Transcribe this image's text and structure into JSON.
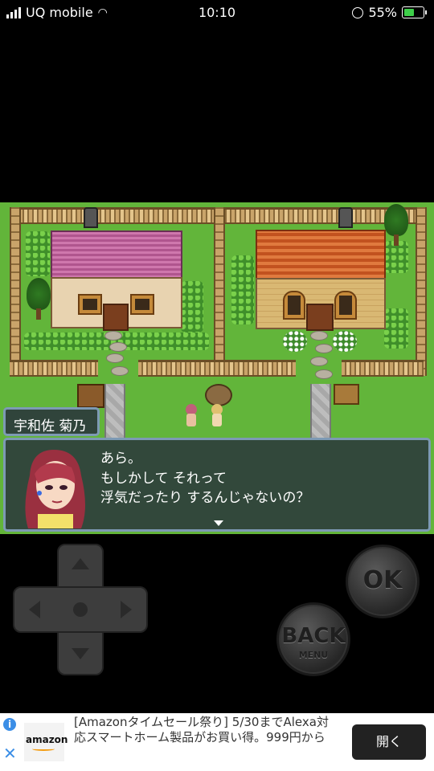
{
  "status_bar": {
    "carrier": "UQ mobile",
    "time": "10:10",
    "battery": "55%",
    "battery_level": 0.55
  },
  "dialogue": {
    "speaker": "宇和佐 菊乃",
    "lines": [
      "あら。",
      "もしかして それって",
      "浮気だったり するんじゃないの？"
    ]
  },
  "controls": {
    "ok_label": "OK",
    "back_label": "BACK",
    "menu_label": "MENU"
  },
  "ad": {
    "logo_text": "amazon",
    "text": "[Amazonタイムセール祭り] 5/30までAlexa対応スマートホーム製品がお買い得。999円から",
    "button": "開く"
  }
}
